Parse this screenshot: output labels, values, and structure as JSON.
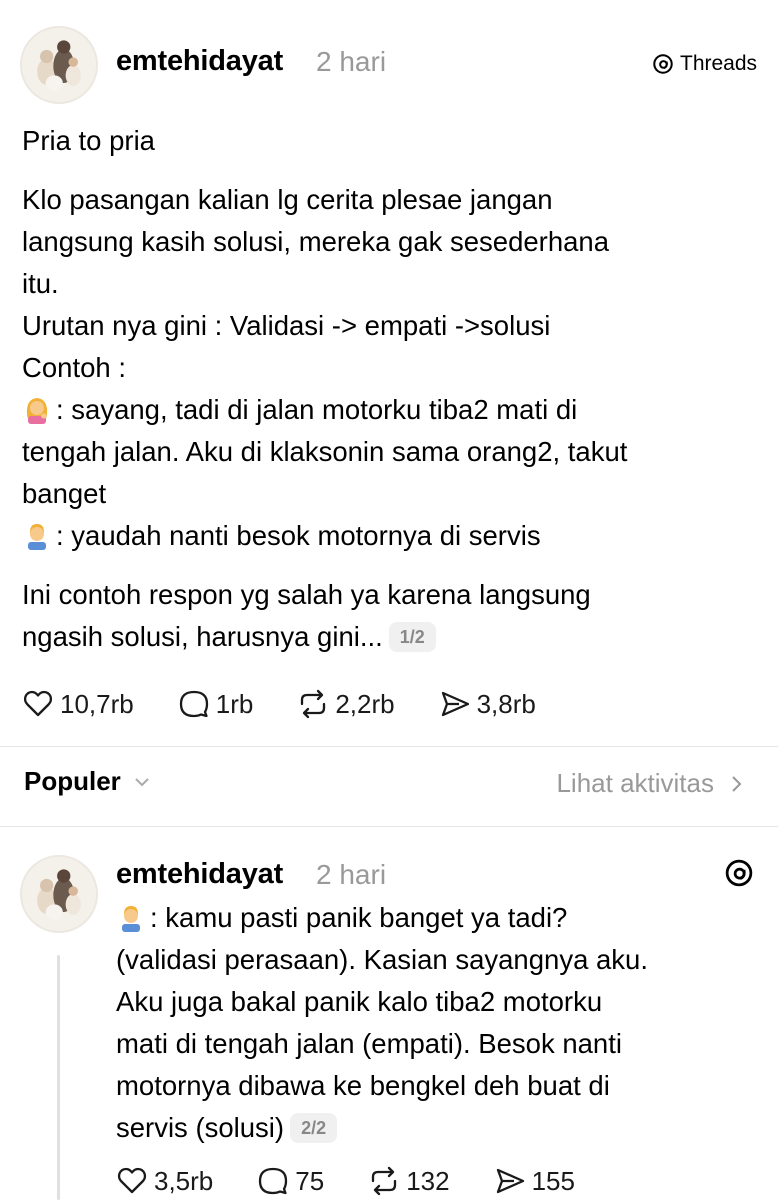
{
  "post": {
    "username": "emtehidayat",
    "time": "2 hari",
    "platform": "Threads",
    "lines": {
      "l1": "Pria to pria",
      "l2": "Klo pasangan kalian lg cerita plesae jangan",
      "l3": "langsung kasih solusi, mereka gak sesederhana",
      "l4": "itu.",
      "l5": "Urutan nya gini : Validasi -> empati ->solusi",
      "l6": "Contoh :",
      "l7": ": sayang, tadi di jalan motorku tiba2 mati di",
      "l8": "tengah jalan. Aku di klaksonin sama orang2, takut",
      "l9": "banget",
      "l10": ": yaudah nanti besok motornya di servis",
      "l11": "Ini contoh respon yg salah ya karena langsung",
      "l12": "ngasih solusi, harusnya gini..."
    },
    "page_counter": "1/2",
    "stats": {
      "likes": "10,7rb",
      "replies": "1rb",
      "reposts": "2,2rb",
      "shares": "3,8rb"
    }
  },
  "sort": {
    "label": "Populer",
    "activity_link": "Lihat aktivitas"
  },
  "reply": {
    "username": "emtehidayat",
    "time": "2 hari",
    "lines": {
      "l1": ": kamu pasti panik banget ya tadi?",
      "l2": "(validasi perasaan). Kasian sayangnya aku.",
      "l3": "Aku juga bakal panik kalo tiba2 motorku",
      "l4": "mati di tengah jalan (empati). Besok nanti",
      "l5": "motornya dibawa ke bengkel deh buat di",
      "l6": "servis (solusi)"
    },
    "page_counter": "2/2",
    "stats": {
      "likes": "3,5rb",
      "replies": "75",
      "reposts": "132",
      "shares": "155"
    }
  },
  "icons": {
    "woman_emoji": "woman-tipping-hand-emoji",
    "man_emoji": "man-emoji",
    "heart": "heart-icon",
    "comment": "comment-bubble-icon",
    "repost": "repost-icon",
    "share": "paper-plane-icon",
    "threads": "threads-logo-icon"
  },
  "colors": {
    "text": "#000000",
    "muted": "#999999",
    "divider": "#e6e6e6",
    "badge_bg": "#f0f0f0"
  }
}
